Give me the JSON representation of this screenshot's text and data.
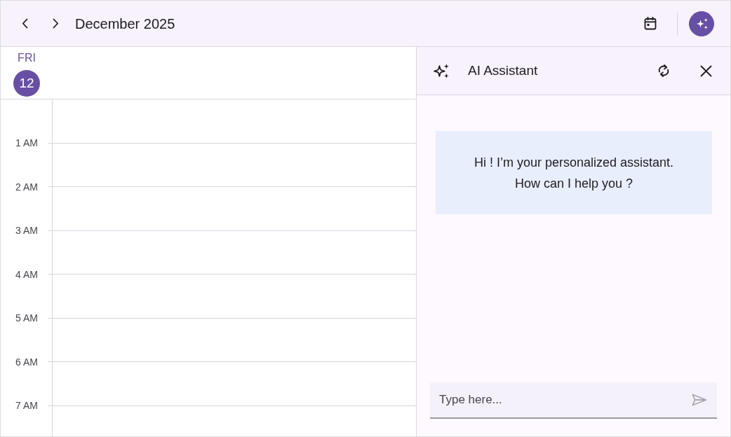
{
  "toolbar": {
    "title": "December 2025",
    "assistant_toggle": {
      "selected": true
    }
  },
  "day": {
    "weekday": "FRI",
    "date": "12",
    "today": true
  },
  "time_slots": [
    "1 AM",
    "2 AM",
    "3 AM",
    "4 AM",
    "5 AM",
    "6 AM",
    "7 AM"
  ],
  "assistant": {
    "title": "AI Assistant",
    "messages": [
      {
        "text": "Hi ! I’m your personalized assistant.\nHow can I help you ?"
      }
    ],
    "input": {
      "placeholder": "Type here..."
    }
  }
}
